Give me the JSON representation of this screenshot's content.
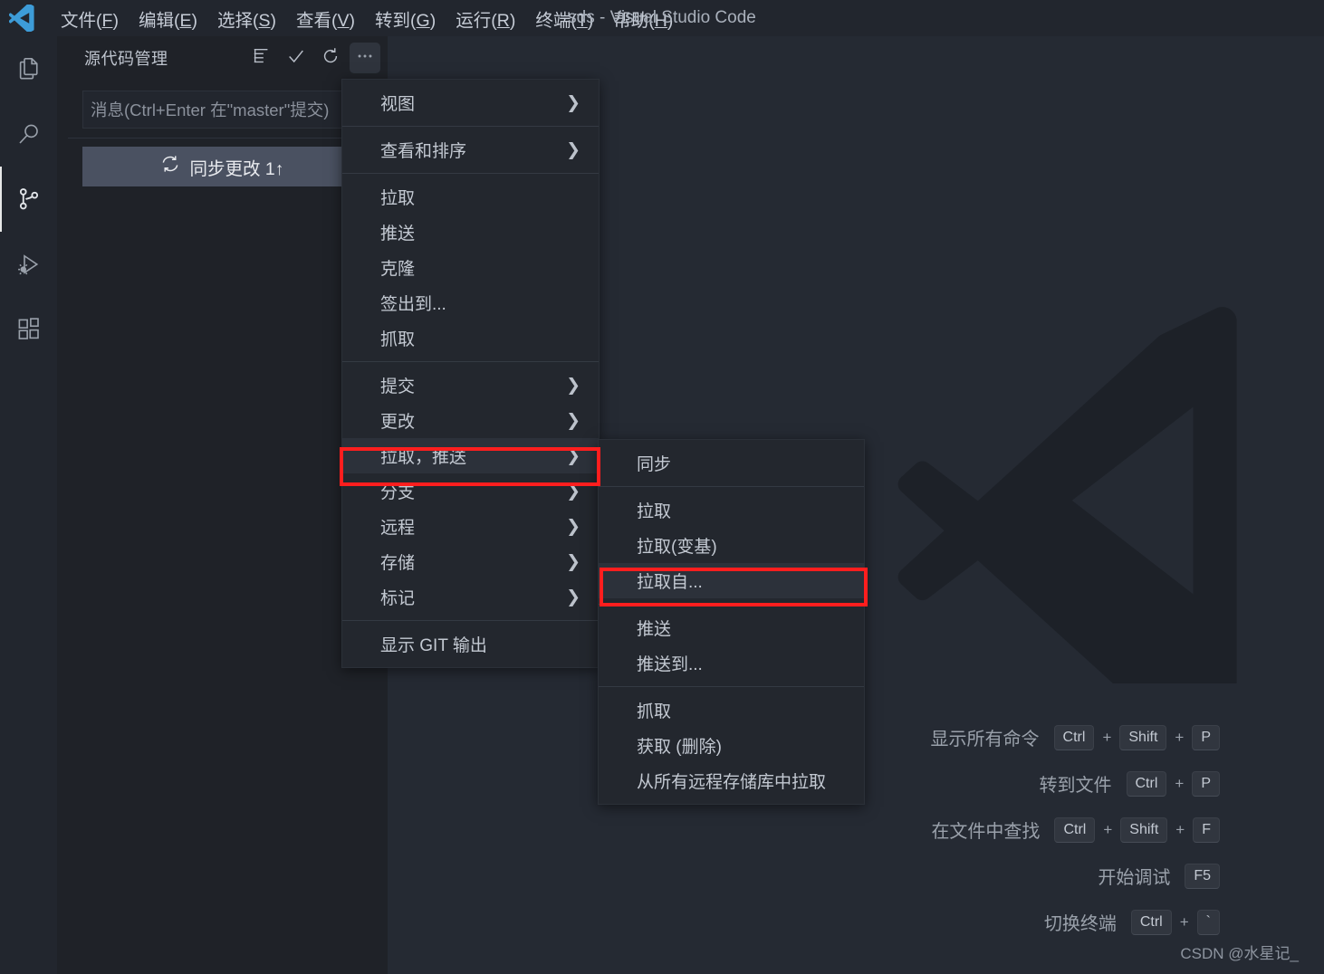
{
  "window": {
    "title": "sds - Visual Studio Code"
  },
  "menubar": [
    {
      "name": "file",
      "label": "文件",
      "accel": "F"
    },
    {
      "name": "edit",
      "label": "编辑",
      "accel": "E"
    },
    {
      "name": "select",
      "label": "选择",
      "accel": "S"
    },
    {
      "name": "view",
      "label": "查看",
      "accel": "V"
    },
    {
      "name": "goto",
      "label": "转到",
      "accel": "G"
    },
    {
      "name": "run",
      "label": "运行",
      "accel": "R"
    },
    {
      "name": "terminal",
      "label": "终端",
      "accel": "T"
    },
    {
      "name": "help",
      "label": "帮助",
      "accel": "H"
    }
  ],
  "activitybar": [
    {
      "name": "explorer",
      "icon": "files-icon",
      "active": false
    },
    {
      "name": "search",
      "icon": "search-icon",
      "active": false
    },
    {
      "name": "source-control",
      "icon": "source-control-icon",
      "active": true
    },
    {
      "name": "run-debug",
      "icon": "run-debug-icon",
      "active": false
    },
    {
      "name": "extensions",
      "icon": "extensions-icon",
      "active": false
    }
  ],
  "sidebar": {
    "title": "源代码管理",
    "actions": [
      {
        "name": "view-as-list",
        "icon": "list-flat-icon"
      },
      {
        "name": "commit",
        "icon": "check-icon"
      },
      {
        "name": "refresh",
        "icon": "refresh-icon"
      },
      {
        "name": "more-actions",
        "icon": "ellipsis-icon",
        "active": true
      }
    ],
    "commit_input_placeholder": "消息(Ctrl+Enter 在\"master\"提交)",
    "commit_input_value": "",
    "sync_button": {
      "icon": "sync-icon",
      "label": "同步更改 1↑"
    }
  },
  "context_menu": {
    "items": [
      {
        "label": "视图",
        "submenu": true,
        "separator_after": true
      },
      {
        "label": "查看和排序",
        "submenu": true,
        "separator_after": true
      },
      {
        "label": "拉取",
        "submenu": false,
        "separator_after": false
      },
      {
        "label": "推送",
        "submenu": false,
        "separator_after": false
      },
      {
        "label": "克隆",
        "submenu": false,
        "separator_after": false
      },
      {
        "label": "签出到...",
        "submenu": false,
        "separator_after": false
      },
      {
        "label": "抓取",
        "submenu": false,
        "separator_after": true
      },
      {
        "label": "提交",
        "submenu": true,
        "separator_after": false
      },
      {
        "label": "更改",
        "submenu": true,
        "separator_after": false
      },
      {
        "label": "拉取，推送",
        "submenu": true,
        "separator_after": false,
        "highlighted": true
      },
      {
        "label": "分支",
        "submenu": true,
        "separator_after": false
      },
      {
        "label": "远程",
        "submenu": true,
        "separator_after": false
      },
      {
        "label": "存储",
        "submenu": true,
        "separator_after": false
      },
      {
        "label": "标记",
        "submenu": true,
        "separator_after": true
      },
      {
        "label": "显示 GIT 输出",
        "submenu": false,
        "separator_after": false
      }
    ]
  },
  "sub_menu": {
    "items": [
      {
        "label": "同步",
        "separator_after": true
      },
      {
        "label": "拉取",
        "separator_after": false
      },
      {
        "label": "拉取(变基)",
        "separator_after": false
      },
      {
        "label": "拉取自...",
        "separator_after": true,
        "highlighted": true
      },
      {
        "label": "推送",
        "separator_after": false
      },
      {
        "label": "推送到...",
        "separator_after": true
      },
      {
        "label": "抓取",
        "separator_after": false
      },
      {
        "label": "获取 (删除)",
        "separator_after": false
      },
      {
        "label": "从所有远程存储库中拉取",
        "separator_after": false
      }
    ]
  },
  "shortcuts": [
    {
      "label": "显示所有命令",
      "keys": [
        "Ctrl",
        "Shift",
        "P"
      ]
    },
    {
      "label": "转到文件",
      "keys": [
        "Ctrl",
        "P"
      ]
    },
    {
      "label": "在文件中查找",
      "keys": [
        "Ctrl",
        "Shift",
        "F"
      ]
    },
    {
      "label": "开始调试",
      "keys": [
        "F5"
      ]
    },
    {
      "label": "切换终端",
      "keys": [
        "Ctrl",
        "`"
      ]
    }
  ],
  "watermark": "CSDN @水星记_",
  "colors": {
    "titlebar_bg": "#22262e",
    "sidebar_bg": "#1f2228",
    "editor_bg": "#252a33",
    "menu_bg": "#23272e",
    "menu_highlight": "#2c313a",
    "sync_button_bg": "#4a5161",
    "annotation_red": "#ff1e1e",
    "text_primary": "#c3c9d2"
  }
}
